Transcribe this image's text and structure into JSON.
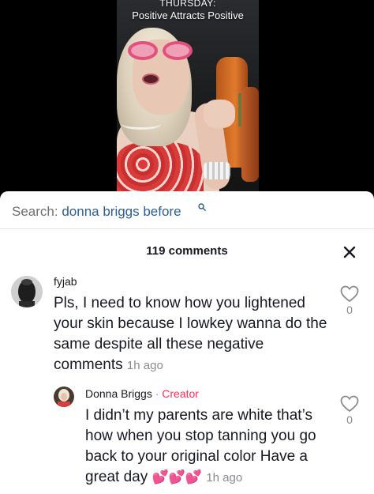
{
  "video": {
    "caption_day": "THURSDAY:",
    "caption_text": "Positive Attracts Positive"
  },
  "search": {
    "prefix": "Search:",
    "query": "donna briggs before",
    "icon": "search-icon"
  },
  "comments_header": {
    "count_label": "119 comments",
    "close_icon": "close-icon"
  },
  "comments": [
    {
      "username": "fyjab",
      "text": "Pls, I need to know how you lightened your skin because I lowkey wanna do the same despite all these negative comments",
      "time": "1h ago",
      "likes": "0"
    },
    {
      "username": "Donna Briggs",
      "separator": " · ",
      "badge": "Creator",
      "text": "I didn’t my parents are white that’s how when you stop tanning you go back to your original color Have a great day",
      "emoji": "💕💕💕",
      "time": "1h ago",
      "likes": "0"
    }
  ],
  "colors": {
    "link": "#2d5d92",
    "creator": "#fe2c55",
    "muted": "#8a8b91"
  }
}
